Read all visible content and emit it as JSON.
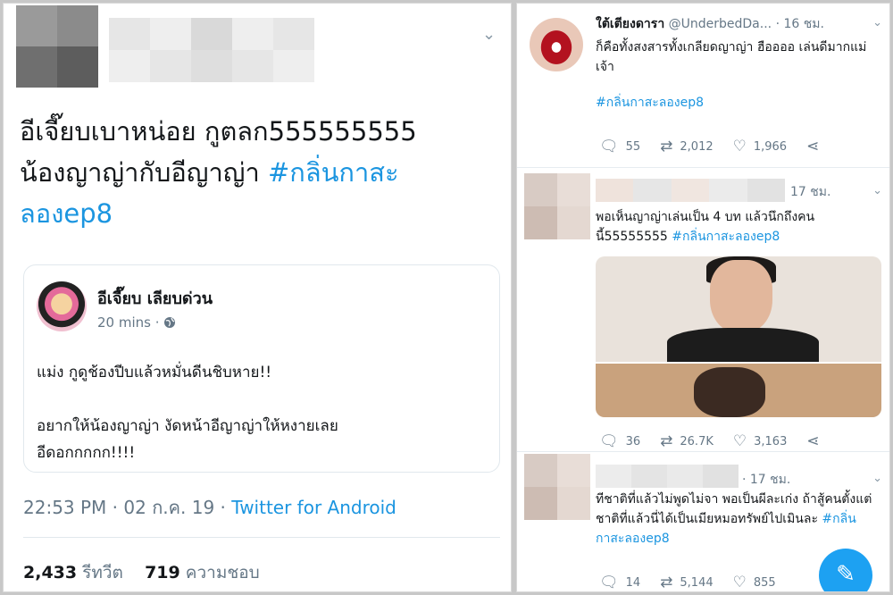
{
  "main_tweet": {
    "text_line1": "อีเจี๊ยบเบาหน่อย กูตลก555555555",
    "text_line2": "น้องญาญ่ากับอีญาญ่า ",
    "hashtag_part1": "#กลิ่นกาสะ",
    "hashtag_part2": "ลองep8",
    "quote": {
      "name": "อีเจี๊ยบ เลียบด่วน",
      "time": "20 mins",
      "globe_icon": "globe-icon",
      "line1": "แม่ง กูดูช้องปีบแล้วหมั่นดีนชิบหาย!!",
      "line2": "อยากให้น้องญาญ่า งัดหน้าอีญาญ่าให้หงายเลย",
      "line3": "อีดอกกกกก!!!!"
    },
    "timestamp": "22:53 PM · 02 ก.ค. 19 · ",
    "source": "Twitter for Android",
    "retweets_count": "2,433",
    "retweets_label": "รีทวีต",
    "likes_count": "719",
    "likes_label": "ความชอบ"
  },
  "replies": [
    {
      "name": "ใต้เตียงดารา",
      "handle": "@UnderbedDa...",
      "time": "· 16 ชม.",
      "text": "ก็คือทั้งสงสารทั้งเกลียดญาญ่า ฮืออออ เล่นดีมากแม่เจ้า",
      "hashtag": "#กลิ่นกาสะลองep8",
      "replies": "55",
      "retweets": "2,012",
      "likes": "1,966"
    },
    {
      "time": "17 ชม.",
      "text": "พอเห็นญาญ่าเล่นเป็น 4 บท แล้วนึกถึงคนนี้55555555 ",
      "hashtag": "#กลิ่นกาสะลองep8",
      "replies": "36",
      "retweets": "26.7K",
      "likes": "3,163"
    },
    {
      "time": "· 17 ชม.",
      "text": "ทีชาติที่แล้วไม่พูดไม่จา พอเป็นผีละเก่ง ถ้าสู้คนตั้งแต่ชาติที่แล้วนี่ได้เป็นเมียหมอทรัพย์ไปเมินละ ",
      "hashtag": "#กลิ่นกาสะลองep8",
      "replies": "14",
      "retweets": "5,144",
      "likes": "855"
    }
  ],
  "icons": {
    "reply": "reply-icon",
    "retweet": "retweet-icon",
    "like": "heart-icon",
    "share": "share-icon",
    "compose": "compose-icon"
  },
  "colors": {
    "link": "#1b95e0",
    "fab": "#1da1f2",
    "muted": "#657786"
  }
}
